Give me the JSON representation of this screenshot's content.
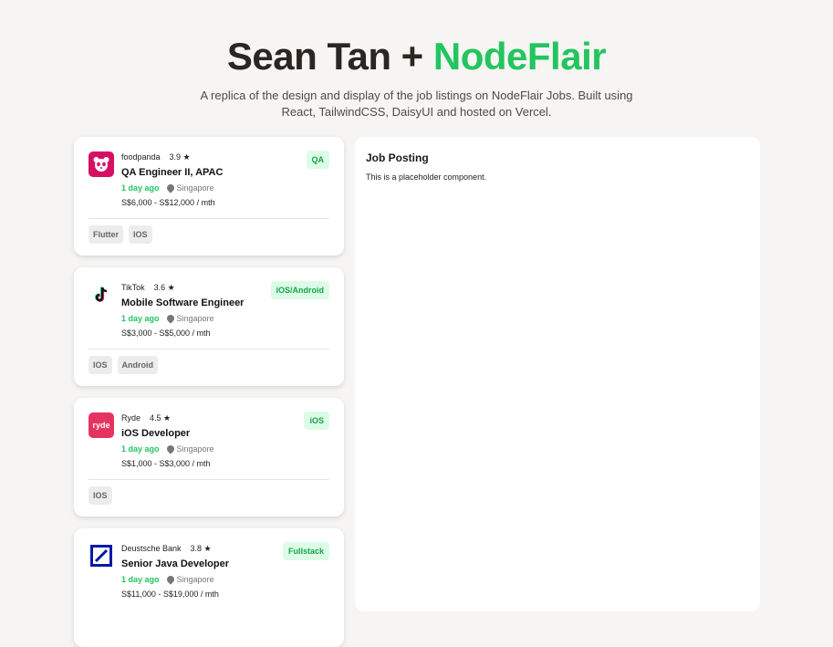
{
  "hero": {
    "title_name": "Sean Tan + ",
    "title_brand": "NodeFlair",
    "subtitle": "A replica of the design and display of the job listings on NodeFlair Jobs. Built using React, TailwindCSS, DaisyUI and hosted on Vercel."
  },
  "jobs": [
    {
      "company": "foodpanda",
      "rating": "3.9 ★",
      "title": "QA Engineer II, APAC",
      "posted": "1 day ago",
      "location": "Singapore",
      "salary": "S$6,000 - S$12,000 / mth",
      "tag": "QA",
      "skills": [
        "Flutter",
        "IOS"
      ],
      "logo_color": "#d70f64",
      "logo_icon": "panda-icon"
    },
    {
      "company": "TikTok",
      "rating": "3.6 ★",
      "title": "Mobile Software Engineer",
      "posted": "1 day ago",
      "location": "Singapore",
      "salary": "S$3,000 - S$5,000 / mth",
      "tag": "iOS/Android",
      "skills": [
        "IOS",
        "Android"
      ],
      "logo_color": "#ffffff",
      "logo_icon": "tiktok-icon"
    },
    {
      "company": "Ryde",
      "rating": "4.5 ★",
      "title": "iOS Developer",
      "posted": "1 day ago",
      "location": "Singapore",
      "salary": "S$1,000 - S$3,000 / mth",
      "tag": "iOS",
      "skills": [
        "IOS"
      ],
      "logo_color": "#e63462",
      "logo_text": "ryde"
    },
    {
      "company": "Deustsche Bank",
      "rating": "3.8 ★",
      "title": "Senior Java Developer",
      "posted": "1 day ago",
      "location": "Singapore",
      "salary": "S$11,000 - S$19,000 / mth",
      "tag": "Fullstack",
      "skills": [],
      "logo_color": "#0018a8",
      "logo_icon": "deutsche-bank-icon"
    }
  ],
  "panel": {
    "title": "Job Posting",
    "body": "This is a placeholder component."
  },
  "colors": {
    "accent": "#22c55e",
    "background": "#f6f5f3"
  }
}
